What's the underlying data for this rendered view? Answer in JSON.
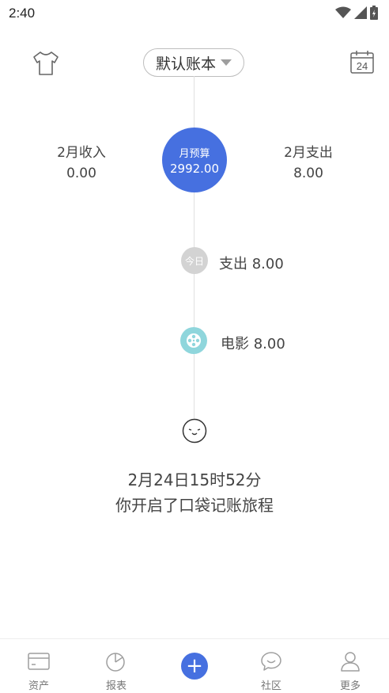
{
  "status_bar": {
    "time": "2:40"
  },
  "header": {
    "book_name": "默认账本",
    "calendar_day": "24"
  },
  "summary": {
    "income_label": "2月收入",
    "income_value": "0.00",
    "expense_label": "2月支出",
    "expense_value": "8.00",
    "budget_label": "月预算",
    "budget_value": "2992.00"
  },
  "timeline": {
    "day_badge": "今日",
    "day_total": "支出 8.00",
    "entries": [
      {
        "category": "电影",
        "amount": "8.00",
        "text": "电影 8.00",
        "icon": "film-icon"
      }
    ]
  },
  "start_message": {
    "line1": "2月24日15时52分",
    "line2": "你开启了口袋记账旅程"
  },
  "bottom_nav": {
    "items": [
      {
        "label": "资产",
        "icon": "wallet-card-icon"
      },
      {
        "label": "报表",
        "icon": "pie-chart-icon"
      },
      {
        "label": "",
        "icon": "plus-icon"
      },
      {
        "label": "社区",
        "icon": "chat-bubble-icon"
      },
      {
        "label": "更多",
        "icon": "person-icon"
      }
    ]
  },
  "colors": {
    "accent": "#4670e0",
    "film_icon_bg": "#8fd6dc",
    "today_badge_bg": "#d3d3d3"
  }
}
